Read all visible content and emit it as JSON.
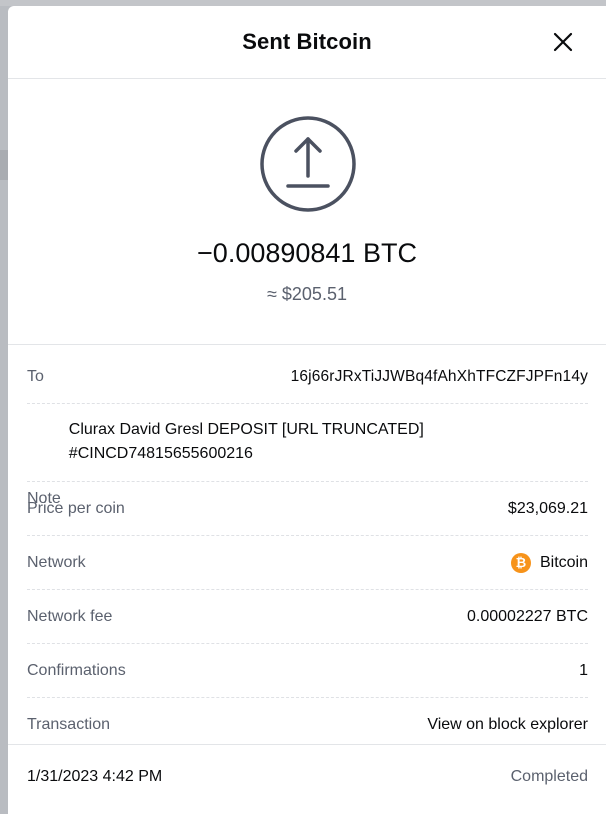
{
  "modal": {
    "title": "Sent Bitcoin",
    "close_icon": "close-icon"
  },
  "summary": {
    "icon": "upload-arrow-icon",
    "amount": "−0.00890841 BTC",
    "fiat_amount": "≈ $205.51"
  },
  "details": {
    "to_label": "To",
    "to_value": "16j66rJRxTiJJWBq4fAhXhTFCZFJPFn14y",
    "note_label": "Note",
    "note_value": "Clurax David Gresl DEPOSIT [URL TRUNCATED] #CINCD74815655600216",
    "price_label": "Price per coin",
    "price_value": "$23,069.21",
    "network_label": "Network",
    "network_icon": "bitcoin-icon",
    "network_icon_glyph": "₿",
    "network_value": "Bitcoin",
    "fee_label": "Network fee",
    "fee_value": "0.00002227 BTC",
    "confirmations_label": "Confirmations",
    "confirmations_value": "1",
    "transaction_label": "Transaction",
    "transaction_link": "View on block explorer"
  },
  "footer": {
    "date": "1/31/2023 4:42 PM",
    "status": "Completed"
  },
  "colors": {
    "link": "#0052ff",
    "bitcoin": "#f7931a",
    "secondary_text": "#5b616e",
    "icon_stroke": "#4b5160"
  }
}
